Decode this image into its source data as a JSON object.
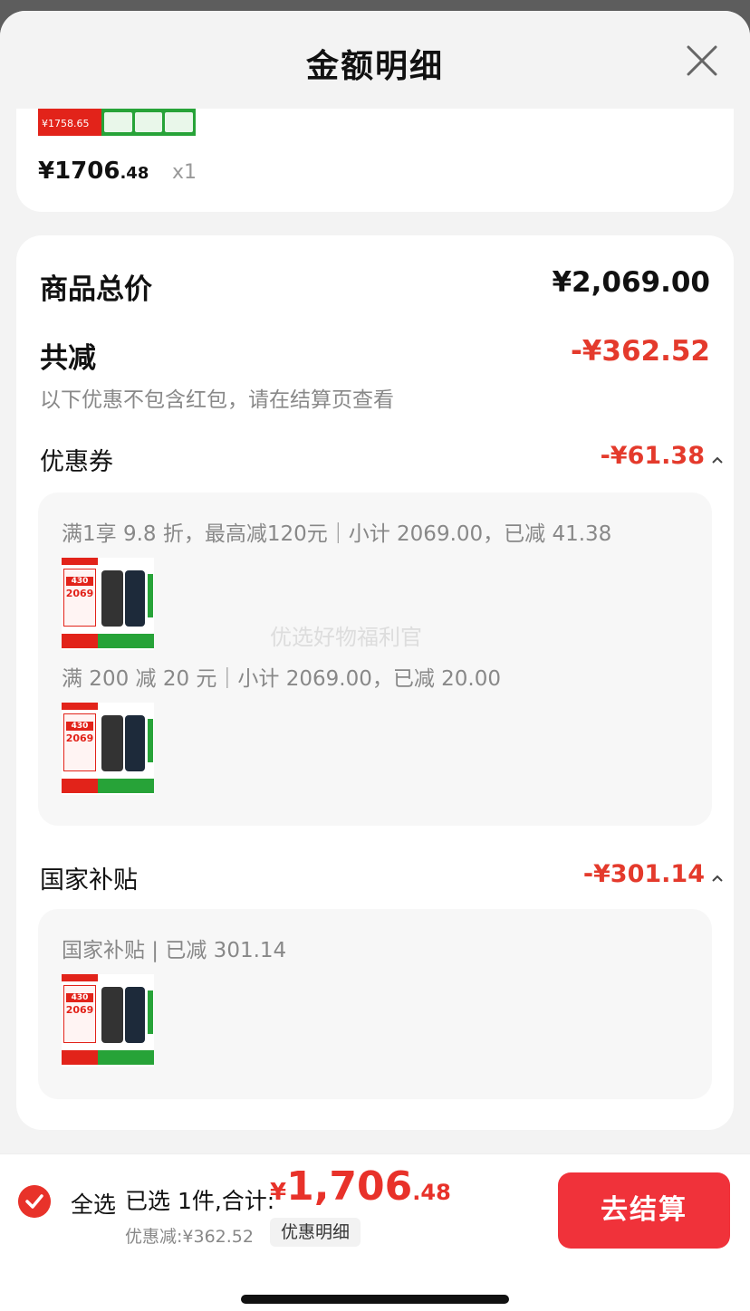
{
  "sheet": {
    "title": "金额明细"
  },
  "product": {
    "price_int": "¥1706",
    "price_dec": ".48",
    "quantity": "x1",
    "thumb_price": "¥1758.65"
  },
  "summary": {
    "total_label": "商品总价",
    "total_value": "¥2,069.00",
    "discount_label": "共减",
    "discount_value": "-¥362.52",
    "note": "以下优惠不包含红包，请在结算页查看"
  },
  "coupon": {
    "label": "优惠券",
    "value": "-¥61.38",
    "rules": [
      {
        "text": "满1享 9.8 折，最高减120元｜小计 2069.00，已减 41.38"
      },
      {
        "text": "满 200 减 20 元｜小计 2069.00，已减 20.00"
      }
    ]
  },
  "subsidy": {
    "label": "国家补贴",
    "value": "-¥301.14",
    "rule": "国家补贴 | 已减 301.14"
  },
  "thumb": {
    "badge": "430",
    "price": "2069"
  },
  "watermark": "优选好物福利官",
  "bottom": {
    "select_all": "全选",
    "selected_label": "已选 1件,合计:",
    "currency": "¥",
    "amount_int": "1,706",
    "amount_dec": ".48",
    "saved": "优惠减:¥362.52",
    "detail_button": "优惠明细",
    "checkout_button": "去结算"
  },
  "colors": {
    "accent": "#e8322a",
    "checkout": "#f0323a",
    "discount_text": "#e43a2c"
  },
  "icons": {
    "close": "close-icon",
    "caret": "caret-up-icon",
    "check": "check-circle-icon"
  }
}
